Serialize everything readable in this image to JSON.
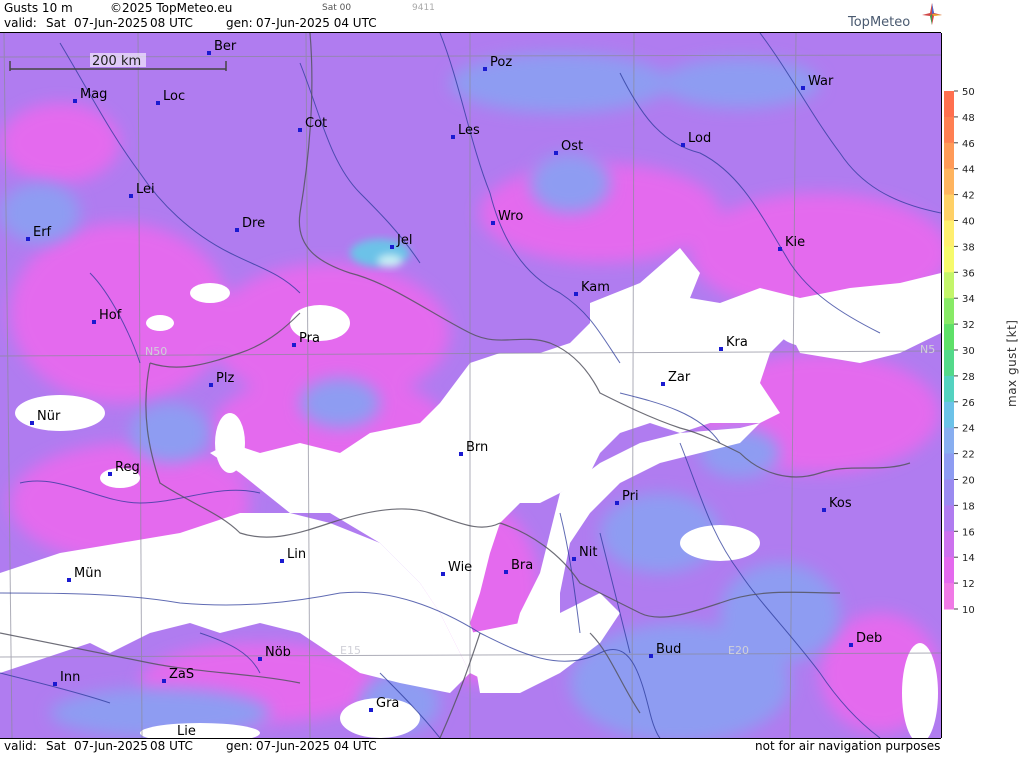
{
  "header": {
    "title": "Gusts 10 m",
    "copyright": "©2025 TopMeteo.eu",
    "sat": "Sat 00",
    "code": "9411",
    "valid_label": "valid:",
    "valid_day": "Sat",
    "valid_date": "07-Jun-2025",
    "valid_time": "08 UTC",
    "gen_label": "gen:",
    "gen_date": "07-Jun-2025 04 UTC",
    "brand": "TopMeteo"
  },
  "footer": {
    "valid_label": "valid:",
    "valid_day": "Sat",
    "valid_date": "07-Jun-2025",
    "valid_time": "08 UTC",
    "gen_label": "gen:",
    "gen_date": "07-Jun-2025 04 UTC",
    "disclaimer": "not for air navigation purposes"
  },
  "scale_bar": {
    "label": "200 km"
  },
  "grid_labels": {
    "n50": "N50",
    "n5_right": "N5",
    "e15": "E15",
    "e20": "E20"
  },
  "legend": {
    "title": "max  gust  [kt]",
    "values": [
      50,
      48,
      46,
      44,
      42,
      40,
      38,
      36,
      34,
      32,
      30,
      28,
      26,
      24,
      22,
      20,
      18,
      16,
      14,
      12,
      10
    ],
    "colors": [
      "#ff6f4f",
      "#ff7f52",
      "#ff9a58",
      "#ffb45f",
      "#ffd066",
      "#ffee6f",
      "#f6fa6c",
      "#c4f56a",
      "#88ea66",
      "#5fe068",
      "#54d98a",
      "#54d2c0",
      "#6cc2e8",
      "#88aef0",
      "#8e9cf2",
      "#9a8af0",
      "#b07cf0",
      "#cc72ee",
      "#e46aee",
      "#f07ae6"
    ]
  },
  "cities": [
    {
      "name": "Ber"
    },
    {
      "name": "Poz"
    },
    {
      "name": "War"
    },
    {
      "name": "Mag"
    },
    {
      "name": "Loc"
    },
    {
      "name": "Cot"
    },
    {
      "name": "Les"
    },
    {
      "name": "Ost"
    },
    {
      "name": "Lod"
    },
    {
      "name": "Lei"
    },
    {
      "name": "Erf"
    },
    {
      "name": "Dre"
    },
    {
      "name": "Jel"
    },
    {
      "name": "Wro"
    },
    {
      "name": "Kie"
    },
    {
      "name": "Kam"
    },
    {
      "name": "Hof"
    },
    {
      "name": "Pra"
    },
    {
      "name": "Kra"
    },
    {
      "name": "Zar"
    },
    {
      "name": "Plz"
    },
    {
      "name": "Nür"
    },
    {
      "name": "Brn"
    },
    {
      "name": "Reg"
    },
    {
      "name": "Pri"
    },
    {
      "name": "Kos"
    },
    {
      "name": "Lin"
    },
    {
      "name": "Nit"
    },
    {
      "name": "Mün"
    },
    {
      "name": "Wie"
    },
    {
      "name": "Bra"
    },
    {
      "name": "Bud"
    },
    {
      "name": "Deb"
    },
    {
      "name": "Nöb"
    },
    {
      "name": "Inn"
    },
    {
      "name": "ZaS"
    },
    {
      "name": "Gra"
    },
    {
      "name": "Lie"
    }
  ]
}
